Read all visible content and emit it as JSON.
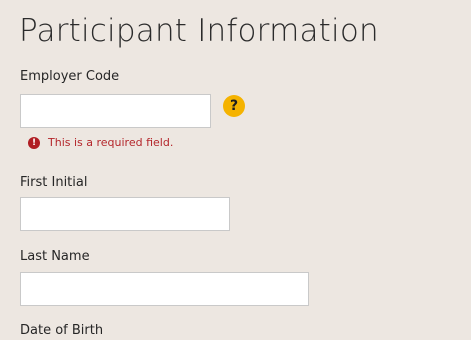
{
  "page": {
    "title": "Participant Information"
  },
  "form": {
    "employer_code": {
      "label": "Employer Code",
      "value": "",
      "help_icon": "?",
      "error_icon": "!",
      "error": "This is a required field."
    },
    "first_initial": {
      "label": "First Initial",
      "value": ""
    },
    "last_name": {
      "label": "Last Name",
      "value": ""
    },
    "date_of_birth": {
      "label": "Date of Birth"
    }
  },
  "icons": {
    "help": "question-mark-circle",
    "error": "exclamation-circle"
  },
  "colors": {
    "background": "#ede7e1",
    "help_icon": "#f5b300",
    "error": "#b4262b",
    "input_border": "#c9c9c9"
  }
}
